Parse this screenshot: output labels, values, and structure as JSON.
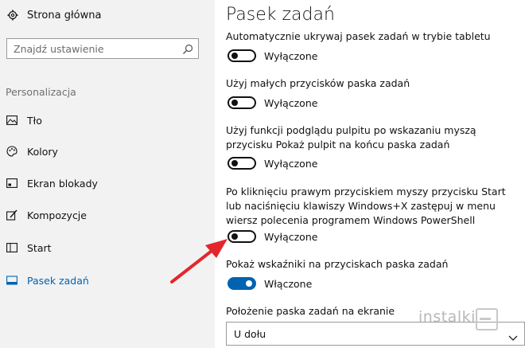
{
  "sidebar": {
    "home_label": "Strona główna",
    "search_placeholder": "Znajdź ustawienie",
    "section_label": "Personalizacja",
    "items": [
      {
        "label": "Tło",
        "icon": "picture-icon"
      },
      {
        "label": "Kolory",
        "icon": "palette-icon"
      },
      {
        "label": "Ekran blokady",
        "icon": "lock-screen-icon"
      },
      {
        "label": "Kompozycje",
        "icon": "themes-brush-icon"
      },
      {
        "label": "Start",
        "icon": "start-grid-icon"
      },
      {
        "label": "Pasek zadań",
        "icon": "taskbar-icon",
        "active": true
      }
    ]
  },
  "main": {
    "title": "Pasek zadań",
    "settings": [
      {
        "label": "Automatycznie ukrywaj pasek zadań w trybie tabletu",
        "state": "Wyłączone",
        "on": false
      },
      {
        "label": "Użyj małych przycisków paska zadań",
        "state": "Wyłączone",
        "on": false
      },
      {
        "label": "Użyj funkcji podglądu pulpitu po wskazaniu myszą przycisku Pokaż pulpit na końcu paska zadań",
        "state": "Wyłączone",
        "on": false
      },
      {
        "label": "Po kliknięciu prawym przyciskiem myszy przycisku Start lub naciśnięciu klawiszy Windows+X zastępuj w menu wiersz polecenia programem Windows PowerShell",
        "state": "Wyłączone",
        "on": false
      },
      {
        "label": "Pokaż wskaźniki na przyciskach paska zadań",
        "state": "Włączone",
        "on": true
      }
    ],
    "position_label": "Położenie paska zadań na ekranie",
    "position_value": "U dołu"
  },
  "watermark": "instalki",
  "colors": {
    "accent": "#0063b1",
    "arrow": "#e3262b",
    "sidebar_bg": "#f2f2f2"
  }
}
